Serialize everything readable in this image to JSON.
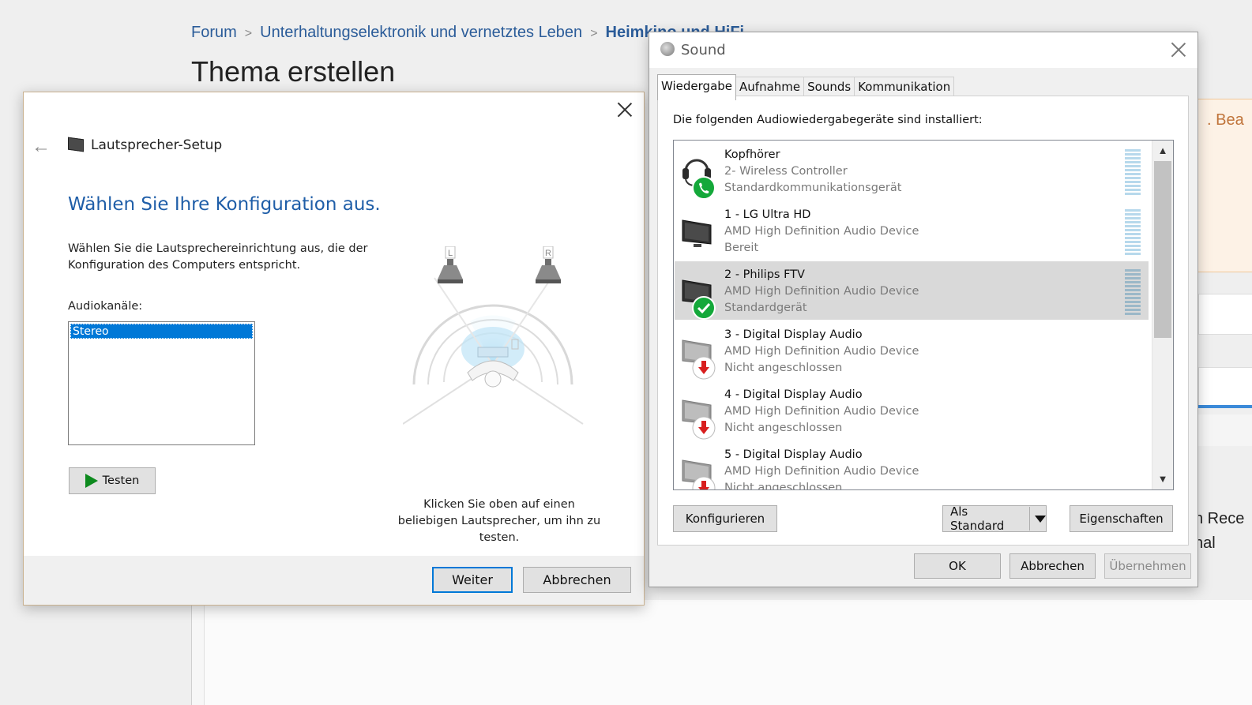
{
  "forum": {
    "breadcrumb": [
      "Forum",
      "Unterhaltungselektronik und vernetztes Leben",
      "Heimkino und HiFi"
    ],
    "page_title": "Thema erstellen",
    "notice_fragment": ". Bea",
    "side_fragments": [
      "n Rece",
      "nal"
    ]
  },
  "speaker_setup": {
    "header_title": "Lautsprecher-Setup",
    "heading": "Wählen Sie Ihre Konfiguration aus.",
    "description": "Wählen Sie die Lautsprechereinrichtung aus, die der Konfiguration des Computers entspricht.",
    "channels_label": "Audiokanäle:",
    "channels": [
      "Stereo"
    ],
    "selected_channel": "Stereo",
    "test_button": "Testen",
    "hint": "Klicken Sie oben auf einen beliebigen Lautsprecher, um ihn zu testen.",
    "speaker_left": "L",
    "speaker_right": "R",
    "next_button": "Weiter",
    "cancel_button": "Abbrechen"
  },
  "sound": {
    "title": "Sound",
    "tabs": [
      "Wiedergabe",
      "Aufnahme",
      "Sounds",
      "Kommunikation"
    ],
    "active_tab": "Wiedergabe",
    "caption": "Die folgenden Audiowiedergabegeräte sind installiert:",
    "devices": [
      {
        "name": "Kopfhörer",
        "sub": "2- Wireless Controller",
        "status": "Standardkommunikationsgerät",
        "icon": "headset-icon",
        "badge": "phone-badge-icon"
      },
      {
        "name": "1 - LG Ultra HD",
        "sub": "AMD High Definition Audio Device",
        "status": "Bereit",
        "icon": "monitor-icon",
        "badge": ""
      },
      {
        "name": "2 - Philips FTV",
        "sub": "AMD High Definition Audio Device",
        "status": "Standardgerät",
        "icon": "monitor-icon",
        "badge": "checkmark-badge-icon"
      },
      {
        "name": "3 - Digital Display Audio",
        "sub": "AMD High Definition Audio Device",
        "status": "Nicht angeschlossen",
        "icon": "monitor-icon",
        "badge": "disconnected-badge-icon"
      },
      {
        "name": "4 - Digital Display Audio",
        "sub": "AMD High Definition Audio Device",
        "status": "Nicht angeschlossen",
        "icon": "monitor-icon",
        "badge": "disconnected-badge-icon"
      },
      {
        "name": "5 - Digital Display Audio",
        "sub": "AMD High Definition Audio Device",
        "status": "Nicht angeschlossen",
        "icon": "monitor-icon",
        "badge": "disconnected-badge-icon"
      }
    ],
    "selected_device": "2 - Philips FTV",
    "configure_button": "Konfigurieren",
    "set_default_button": "Als Standard",
    "properties_button": "Eigenschaften",
    "ok_button": "OK",
    "cancel_button": "Abbrechen",
    "apply_button": "Übernehmen",
    "colors": {
      "accent": "#0078d7",
      "ok_green": "#14a83a",
      "error_red": "#d81e1e"
    }
  }
}
